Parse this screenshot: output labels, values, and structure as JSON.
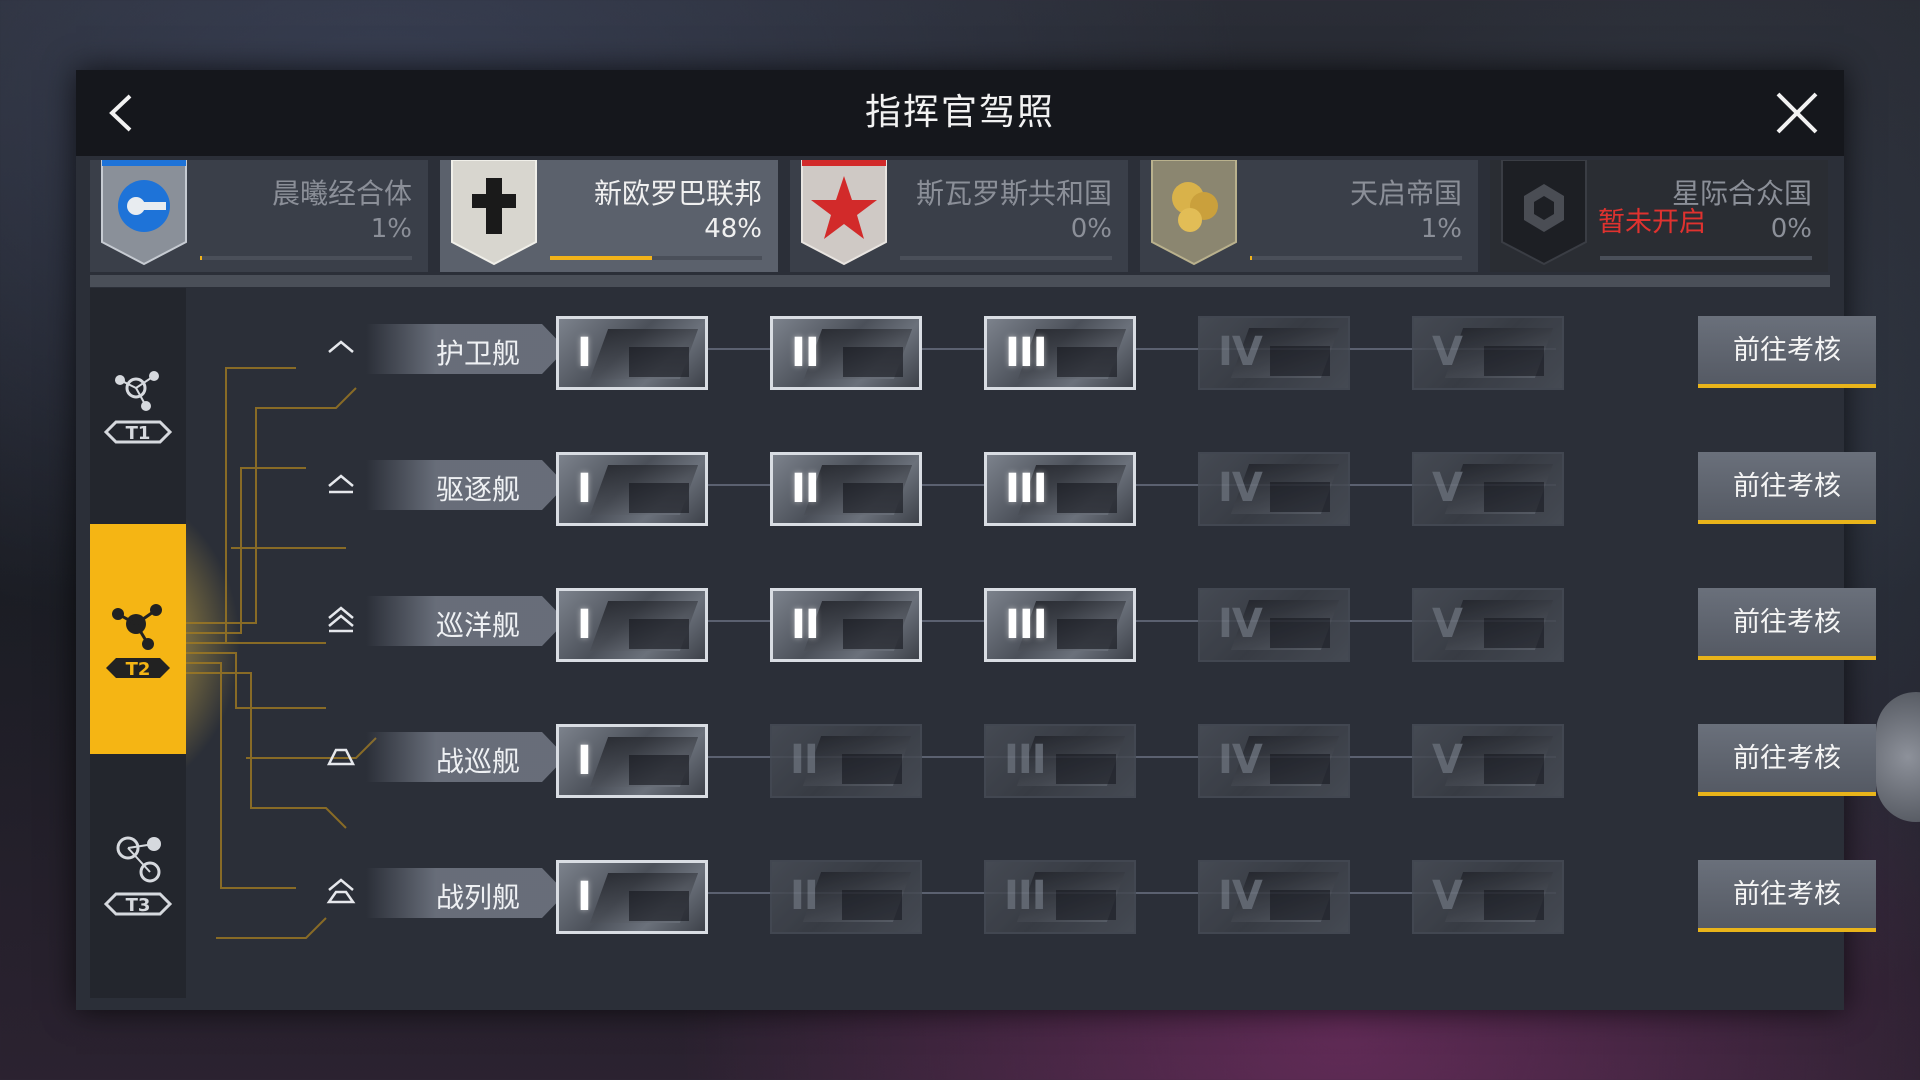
{
  "header": {
    "title": "指挥官驾照"
  },
  "factions": [
    {
      "name": "晨曦经合体",
      "percent": "1%",
      "progress": 0.01,
      "emblem": "blue-circle-emblem",
      "color": "#1e73d8",
      "state": "normal"
    },
    {
      "name": "新欧罗巴联邦",
      "percent": "48%",
      "progress": 0.48,
      "emblem": "cross-emblem",
      "color": "#1a1a1a",
      "state": "active"
    },
    {
      "name": "斯瓦罗斯共和国",
      "percent": "0%",
      "progress": 0.0,
      "emblem": "red-star-emblem",
      "color": "#d22a2a",
      "state": "normal"
    },
    {
      "name": "天启帝国",
      "percent": "1%",
      "progress": 0.01,
      "emblem": "gold-orbs-emblem",
      "color": "#c9a13a",
      "state": "normal"
    },
    {
      "name": "星际合众国",
      "percent": "0%",
      "progress": 0.0,
      "emblem": "hexagon-emblem",
      "color": "#1d1f24",
      "state": "locked",
      "locked_label": "暂未开启"
    }
  ],
  "tiers": [
    {
      "label": "T1",
      "state": "normal"
    },
    {
      "label": "T2",
      "state": "active"
    },
    {
      "label": "T3",
      "state": "normal"
    }
  ],
  "ship_rows": [
    {
      "name": "护卫舰",
      "unlocked": 3,
      "button": "前往考核"
    },
    {
      "name": "驱逐舰",
      "unlocked": 3,
      "button": "前往考核"
    },
    {
      "name": "巡洋舰",
      "unlocked": 3,
      "button": "前往考核"
    },
    {
      "name": "战巡舰",
      "unlocked": 1,
      "button": "前往考核"
    },
    {
      "name": "战列舰",
      "unlocked": 1,
      "button": "前往考核"
    }
  ],
  "level_numerals": [
    "I",
    "II",
    "III",
    "IV",
    "V"
  ],
  "colors": {
    "accent": "#f5b514",
    "locked_text": "#e0322f"
  }
}
